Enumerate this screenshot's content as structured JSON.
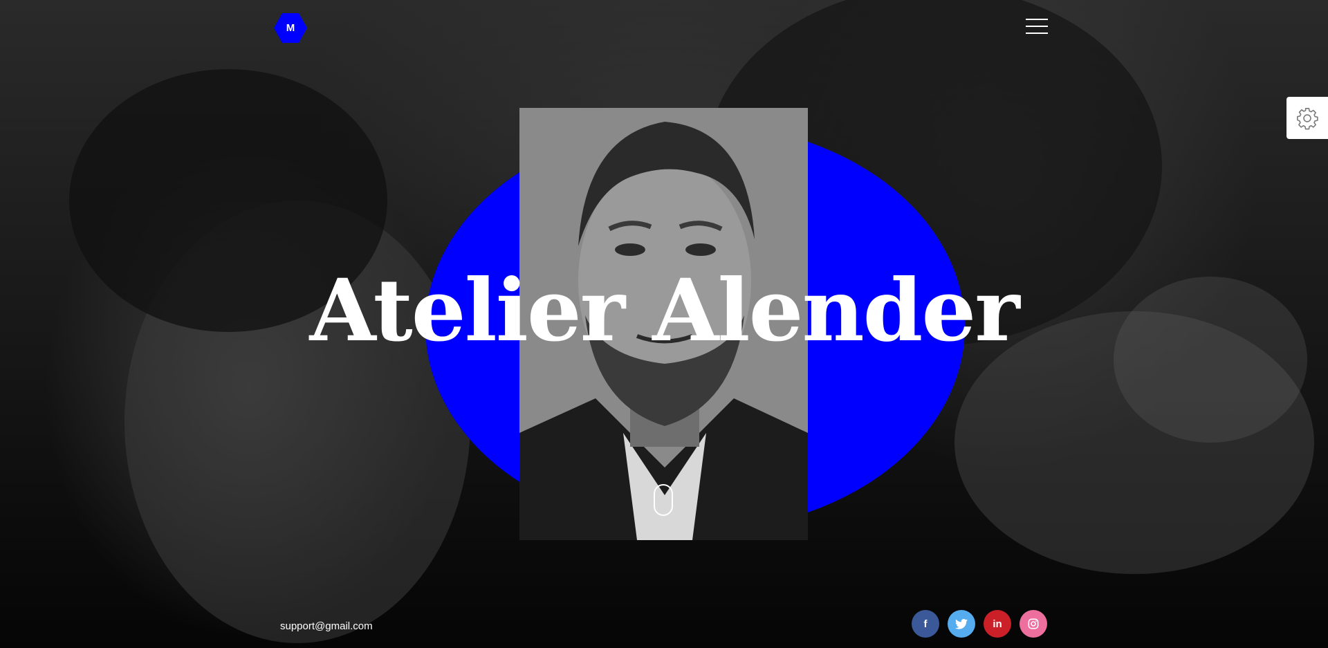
{
  "logo": {
    "letter": "M"
  },
  "hero": {
    "title": "Atelier Alender"
  },
  "footer": {
    "email": "support@gmail.com"
  },
  "social": [
    {
      "name": "facebook",
      "glyph": "f",
      "color": "#3b5998"
    },
    {
      "name": "twitter",
      "glyph": "",
      "color": "#55acee"
    },
    {
      "name": "linkedin",
      "glyph": "in",
      "color": "#cb2027"
    },
    {
      "name": "instagram",
      "glyph": "",
      "color": "#ec6f9d"
    }
  ],
  "colors": {
    "accent": "#0000ff",
    "text": "#ffffff",
    "background": "#000000"
  },
  "icons": {
    "menu": "hamburger-icon",
    "settings": "gear-icon",
    "scroll": "mouse-scroll-icon"
  }
}
